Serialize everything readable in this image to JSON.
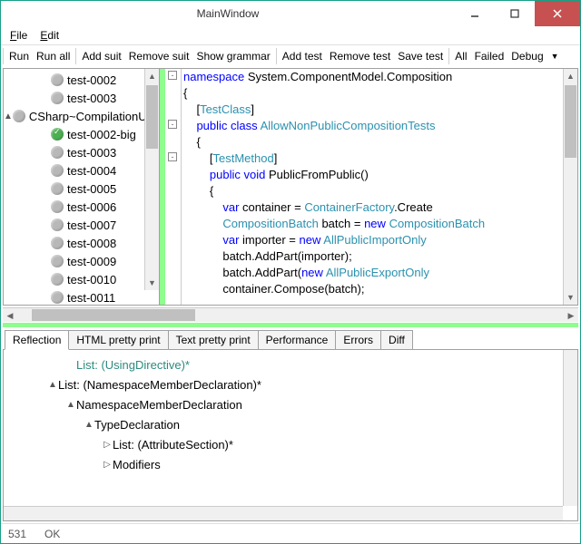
{
  "window": {
    "title": "MainWindow"
  },
  "menu": {
    "file": "File",
    "edit": "Edit"
  },
  "toolbar": {
    "run": "Run",
    "run_all": "Run all",
    "add_suit": "Add suit",
    "remove_suit": "Remove suit",
    "show_grammar": "Show grammar",
    "add_test": "Add test",
    "remove_test": "Remove test",
    "save_test": "Save test",
    "all": "All",
    "failed": "Failed",
    "debug": "Debug"
  },
  "tree": {
    "items": [
      {
        "indent": 40,
        "expander": "",
        "status": "grey",
        "label": "test-0002"
      },
      {
        "indent": 40,
        "expander": "",
        "status": "grey",
        "label": "test-0003"
      },
      {
        "indent": 12,
        "expander": "▲",
        "status": "grey",
        "label": "CSharp~CompilationUnit"
      },
      {
        "indent": 40,
        "expander": "",
        "status": "green",
        "label": "test-0002-big"
      },
      {
        "indent": 40,
        "expander": "",
        "status": "grey",
        "label": "test-0003"
      },
      {
        "indent": 40,
        "expander": "",
        "status": "grey",
        "label": "test-0004"
      },
      {
        "indent": 40,
        "expander": "",
        "status": "grey",
        "label": "test-0005"
      },
      {
        "indent": 40,
        "expander": "",
        "status": "grey",
        "label": "test-0006"
      },
      {
        "indent": 40,
        "expander": "",
        "status": "grey",
        "label": "test-0007"
      },
      {
        "indent": 40,
        "expander": "",
        "status": "grey",
        "label": "test-0008"
      },
      {
        "indent": 40,
        "expander": "",
        "status": "grey",
        "label": "test-0009"
      },
      {
        "indent": 40,
        "expander": "",
        "status": "grey",
        "label": "test-0010"
      },
      {
        "indent": 40,
        "expander": "",
        "status": "grey",
        "label": "test-0011"
      }
    ]
  },
  "code": {
    "fold_tops": [
      2,
      56,
      92
    ],
    "lines": [
      {
        "indent": 0,
        "tokens": [
          [
            "kw",
            "namespace"
          ],
          [
            "",
            " System.ComponentModel.Composition"
          ]
        ]
      },
      {
        "indent": 0,
        "tokens": [
          [
            "",
            "{"
          ]
        ]
      },
      {
        "indent": 1,
        "tokens": [
          [
            "",
            "["
          ],
          [
            "typ",
            "TestClass"
          ],
          [
            "",
            "]"
          ]
        ]
      },
      {
        "indent": 1,
        "tokens": [
          [
            "kw",
            "public"
          ],
          [
            "",
            " "
          ],
          [
            "kw",
            "class"
          ],
          [
            "",
            " "
          ],
          [
            "typ",
            "AllowNonPublicCompositionTests"
          ]
        ]
      },
      {
        "indent": 1,
        "tokens": [
          [
            "",
            "{"
          ]
        ]
      },
      {
        "indent": 2,
        "tokens": [
          [
            "",
            "["
          ],
          [
            "typ",
            "TestMethod"
          ],
          [
            "",
            "]"
          ]
        ]
      },
      {
        "indent": 2,
        "tokens": [
          [
            "kw",
            "public"
          ],
          [
            "",
            " "
          ],
          [
            "kw",
            "void"
          ],
          [
            "",
            " PublicFromPublic()"
          ]
        ]
      },
      {
        "indent": 2,
        "tokens": [
          [
            "",
            "{"
          ]
        ]
      },
      {
        "indent": 3,
        "tokens": [
          [
            "kw",
            "var"
          ],
          [
            "",
            " container = "
          ],
          [
            "typ",
            "ContainerFactory"
          ],
          [
            "",
            ".Create"
          ]
        ]
      },
      {
        "indent": 3,
        "tokens": [
          [
            "typ",
            "CompositionBatch"
          ],
          [
            "",
            " batch = "
          ],
          [
            "kw",
            "new"
          ],
          [
            "",
            " "
          ],
          [
            "typ",
            "CompositionBatch"
          ]
        ]
      },
      {
        "indent": 3,
        "tokens": [
          [
            "kw",
            "var"
          ],
          [
            "",
            " importer = "
          ],
          [
            "kw",
            "new"
          ],
          [
            "",
            " "
          ],
          [
            "typ",
            "AllPublicImportOnly"
          ]
        ]
      },
      {
        "indent": 3,
        "tokens": [
          [
            "",
            "batch.AddPart(importer);"
          ]
        ]
      },
      {
        "indent": 3,
        "tokens": [
          [
            "",
            "batch.AddPart("
          ],
          [
            "kw",
            "new"
          ],
          [
            "",
            " "
          ],
          [
            "typ",
            "AllPublicExportOnly"
          ]
        ]
      },
      {
        "indent": 3,
        "tokens": [
          [
            "",
            "container.Compose(batch);"
          ]
        ]
      }
    ]
  },
  "tabs": {
    "reflection": "Reflection",
    "html": "HTML pretty print",
    "text": "Text pretty print",
    "perf": "Performance",
    "errors": "Errors",
    "diff": "Diff"
  },
  "ast": {
    "rows": [
      {
        "indent": 60,
        "exp": "",
        "teal": true,
        "text": "List: (UsingDirective)*"
      },
      {
        "indent": 40,
        "exp": "▲",
        "teal": false,
        "text": "List: (NamespaceMemberDeclaration)*"
      },
      {
        "indent": 60,
        "exp": "▲",
        "teal": false,
        "text": "NamespaceMemberDeclaration"
      },
      {
        "indent": 80,
        "exp": "▲",
        "teal": false,
        "text": "TypeDeclaration"
      },
      {
        "indent": 100,
        "exp": "▷",
        "teal": false,
        "text": "List: (AttributeSection)*"
      },
      {
        "indent": 100,
        "exp": "▷",
        "teal": false,
        "text": "Modifiers"
      }
    ]
  },
  "status": {
    "left": "531",
    "right": "OK"
  }
}
